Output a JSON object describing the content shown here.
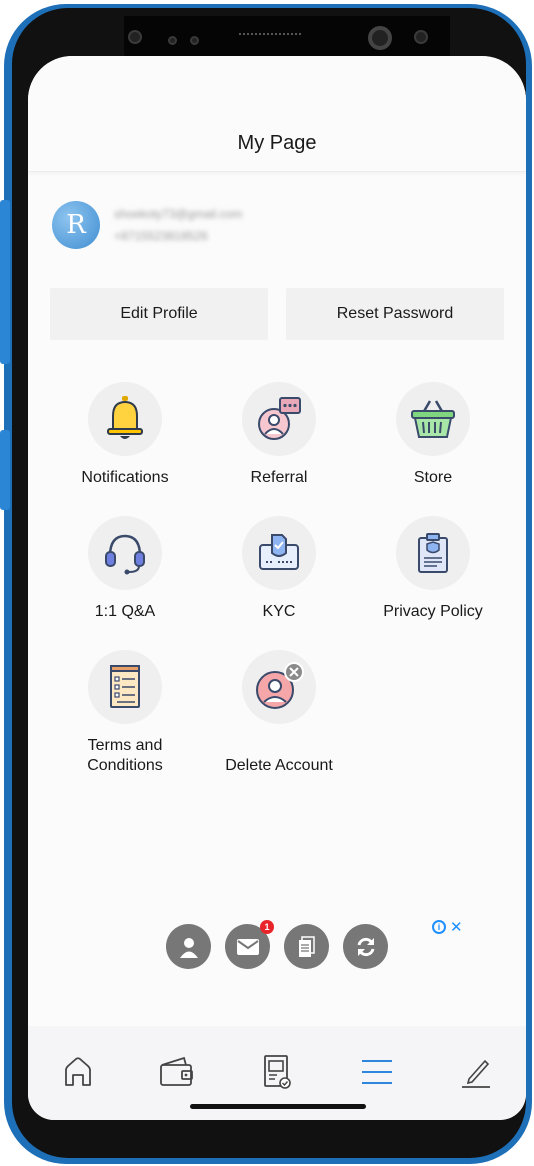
{
  "header": {
    "title": "My Page"
  },
  "profile": {
    "avatar_letter": "R",
    "email": "shoekoty73@gmail.com",
    "phone": "+8715523818526"
  },
  "actions": {
    "edit_profile": "Edit Profile",
    "reset_password": "Reset Password"
  },
  "menu": {
    "items": [
      {
        "label": "Notifications",
        "icon": "bell-icon"
      },
      {
        "label": "Referral",
        "icon": "referral-icon"
      },
      {
        "label": "Store",
        "icon": "basket-icon"
      },
      {
        "label": "1:1 Q&A",
        "icon": "headset-icon"
      },
      {
        "label": "KYC",
        "icon": "id-card-icon"
      },
      {
        "label": "Privacy Policy",
        "icon": "document-shield-icon"
      },
      {
        "label": "Terms and Conditions",
        "icon": "checklist-icon"
      },
      {
        "label": "Delete Account",
        "icon": "delete-user-icon"
      }
    ]
  },
  "ad": {
    "icons": [
      "user-icon",
      "mail-icon",
      "document-icon",
      "refresh-icon"
    ],
    "mail_badge": "1",
    "info_glyph": "i",
    "close_glyph": "✕"
  },
  "bottom_nav": {
    "items": [
      {
        "icon": "home-icon"
      },
      {
        "icon": "wallet-icon"
      },
      {
        "icon": "certificate-icon"
      },
      {
        "icon": "menu-icon",
        "active": true
      },
      {
        "icon": "pencil-icon"
      }
    ],
    "active_color": "#2e86de"
  },
  "colors": {
    "frame": "#1d6fb8",
    "accent": "#2e86de",
    "badge": "#e8252b"
  }
}
